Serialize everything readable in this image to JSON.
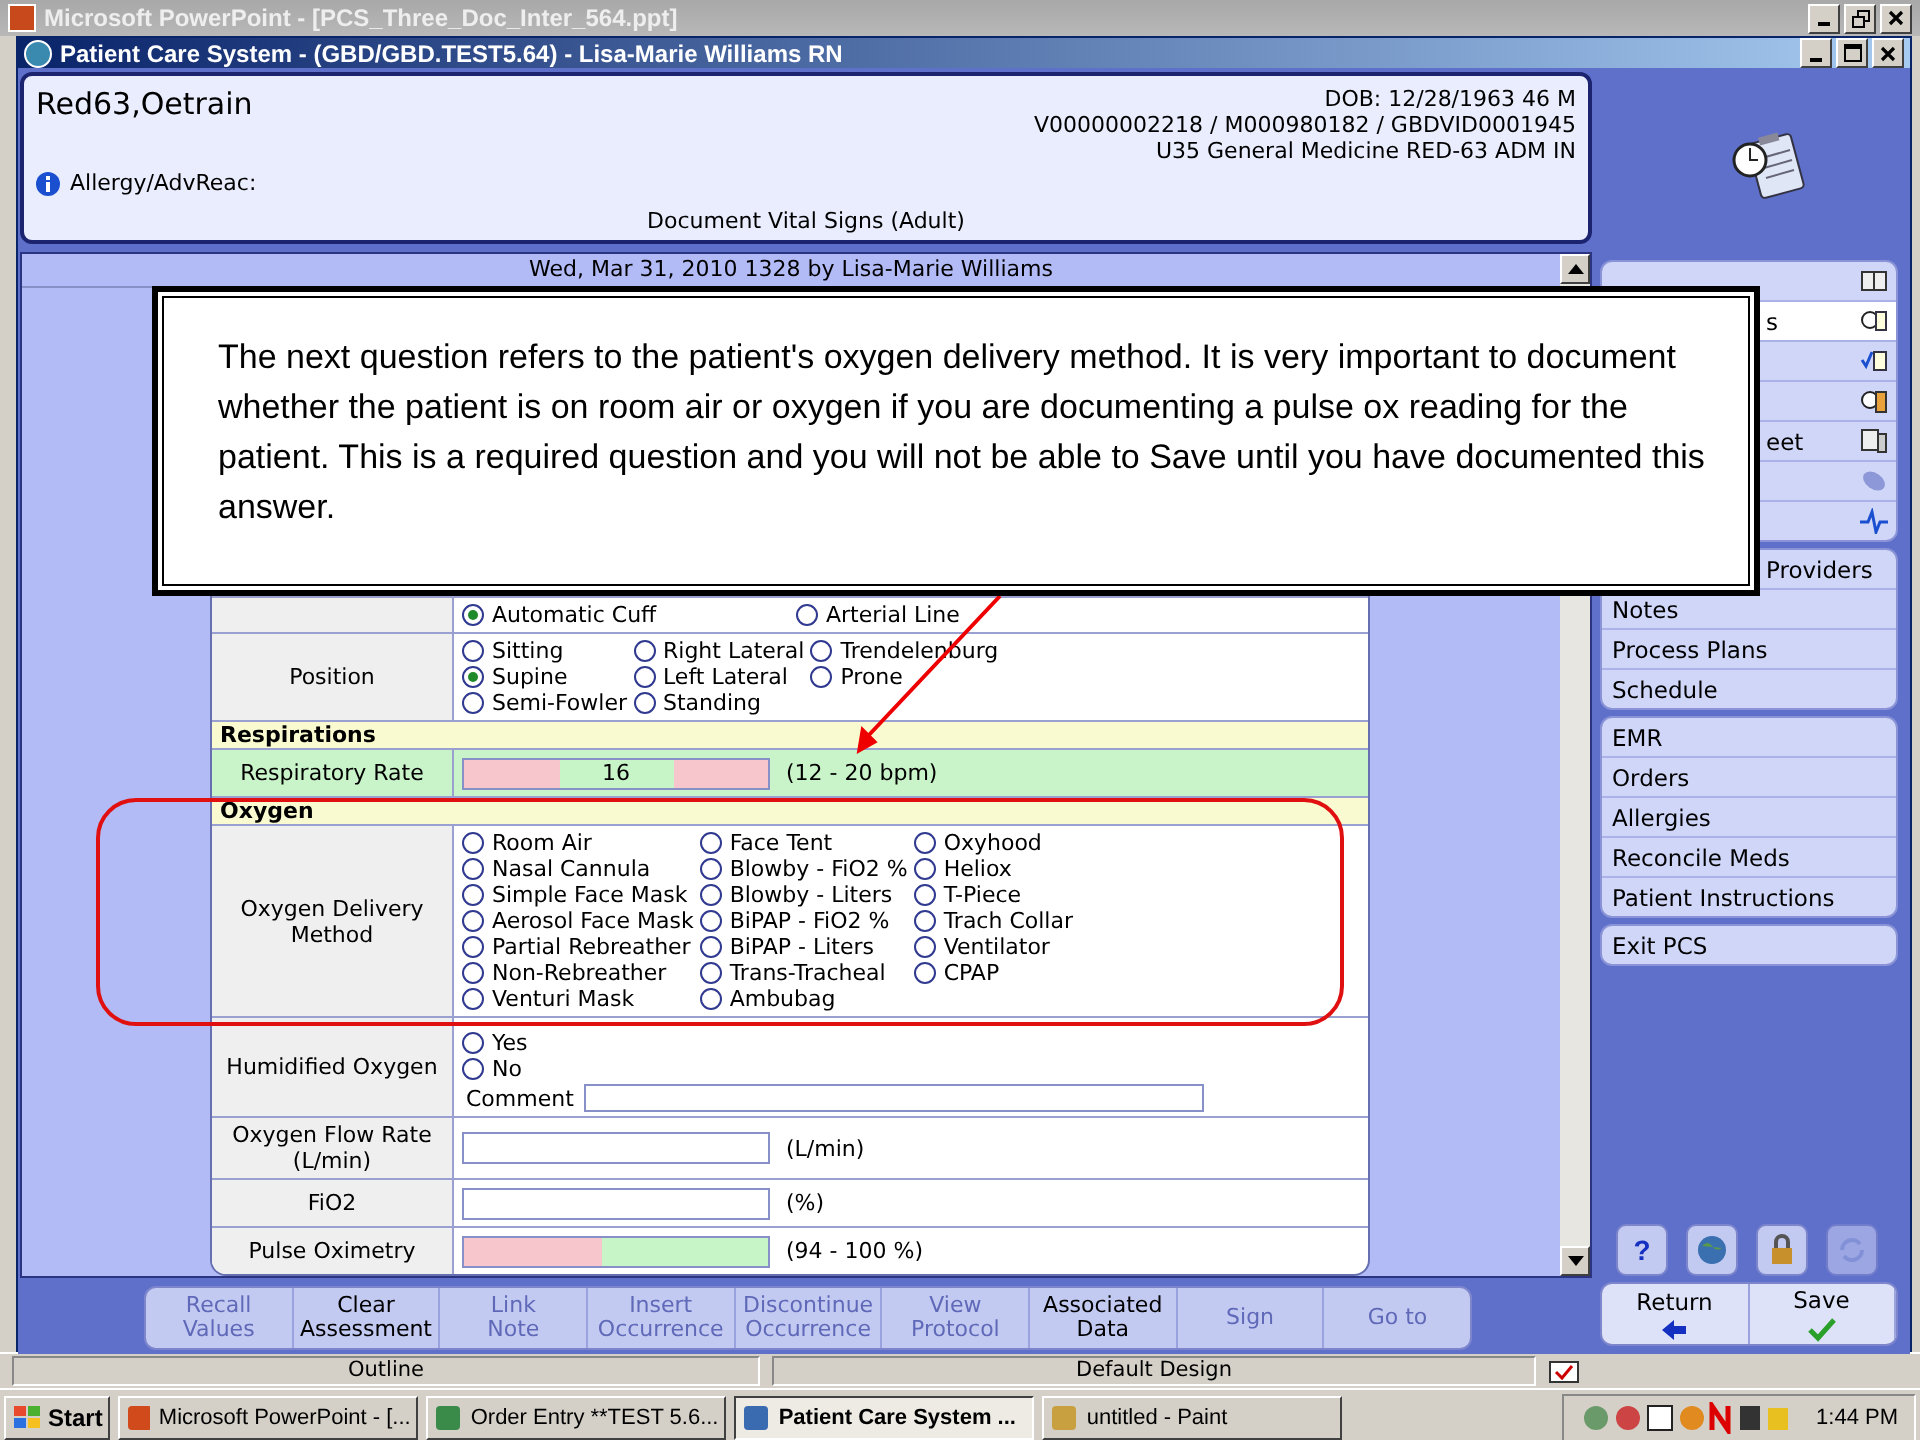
{
  "ppt_window": {
    "title": "Microsoft PowerPoint - [PCS_Three_Doc_Inter_564.ppt]"
  },
  "app_window": {
    "title": "Patient Care System - (GBD/GBD.TEST5.64) - Lisa-Marie Williams RN"
  },
  "patient": {
    "name": "Red63,Oetrain",
    "dob": "DOB: 12/28/1963 46 M",
    "ids": "V00000002218 / M000980182 / GBDVID0001945",
    "location": "U35 General Medicine  RED-63  ADM IN",
    "allergy_label": "Allergy/AdvReac:",
    "document_title": "Document Vital Signs (Adult)"
  },
  "document": {
    "header": "Wed,  Mar 31, 2010 1328  by  Lisa-Marie Williams"
  },
  "form": {
    "rows": [
      {
        "kind": "options",
        "columns": [
          [
            {
              "label": "Automatic Cuff",
              "checked": true
            }
          ],
          [
            {
              "label": "Arterial Line",
              "checked": false
            }
          ]
        ]
      },
      {
        "kind": "options",
        "label": "Position",
        "columns": [
          [
            {
              "label": "Sitting",
              "checked": false
            },
            {
              "label": "Supine",
              "checked": true
            },
            {
              "label": "Semi-Fowler",
              "checked": false
            }
          ],
          [
            {
              "label": "Right Lateral",
              "checked": false
            },
            {
              "label": "Left Lateral",
              "checked": false
            },
            {
              "label": "Standing",
              "checked": false
            }
          ],
          [
            {
              "label": "Trendelenburg",
              "checked": false
            },
            {
              "label": "Prone",
              "checked": false
            }
          ]
        ]
      },
      {
        "kind": "section",
        "label": "Respirations"
      },
      {
        "kind": "range",
        "label": "Respiratory Rate",
        "value": "16",
        "range": "(12 - 20 bpm)",
        "highlight": true,
        "zones": [
          {
            "color": "#f7c6cc"
          },
          {
            "color": "#c8f5c8"
          },
          {
            "color": "#f7c6cc"
          }
        ]
      },
      {
        "kind": "section",
        "label": "Oxygen"
      },
      {
        "kind": "options",
        "label": "Oxygen Delivery Method",
        "columns": [
          [
            {
              "label": "Room Air",
              "checked": false
            },
            {
              "label": "Nasal Cannula",
              "checked": false
            },
            {
              "label": "Simple Face Mask",
              "checked": false
            },
            {
              "label": "Aerosol Face Mask",
              "checked": false
            },
            {
              "label": "Partial Rebreather",
              "checked": false
            },
            {
              "label": "Non-Rebreather",
              "checked": false
            },
            {
              "label": "Venturi Mask",
              "checked": false
            }
          ],
          [
            {
              "label": "Face Tent",
              "checked": false
            },
            {
              "label": "Blowby - FiO2 %",
              "checked": false
            },
            {
              "label": "Blowby - Liters",
              "checked": false
            },
            {
              "label": "BiPAP - FiO2 %",
              "checked": false
            },
            {
              "label": "BiPAP - Liters",
              "checked": false
            },
            {
              "label": "Trans-Tracheal",
              "checked": false
            },
            {
              "label": "Ambubag",
              "checked": false
            }
          ],
          [
            {
              "label": "Oxyhood",
              "checked": false
            },
            {
              "label": "Heliox",
              "checked": false
            },
            {
              "label": "T-Piece",
              "checked": false
            },
            {
              "label": "Trach Collar",
              "checked": false
            },
            {
              "label": "Ventilator",
              "checked": false
            },
            {
              "label": "CPAP",
              "checked": false
            }
          ]
        ]
      },
      {
        "kind": "options",
        "label": "Humidified Oxygen",
        "columns": [
          [
            {
              "label": "Yes",
              "checked": false
            },
            {
              "label": "No",
              "checked": false
            }
          ]
        ],
        "comment_label": "Comment"
      },
      {
        "kind": "input",
        "label": "Oxygen Flow Rate (L/min)",
        "unit": "(L/min)"
      },
      {
        "kind": "input",
        "label": "FiO2",
        "unit": "(%)"
      },
      {
        "kind": "range",
        "label": "Pulse Oximetry",
        "range": "(94 - 100 %)",
        "highlight": false,
        "zones": [
          {
            "color": "#f7c6cc"
          },
          {
            "color": "#c8f5c8"
          }
        ]
      }
    ]
  },
  "overlay": {
    "text": "The next question refers to the patient's oxygen delivery method. It is very important to document whether the patient is on room air or oxygen if you are documenting a pulse ox reading for the patient. This is a required question and you will not be able to Save until you have documented this answer."
  },
  "sidebar": {
    "groups": [
      {
        "items": [
          {
            "selected": false
          },
          {
            "label": "s",
            "selected": true
          },
          {
            "selected": false
          },
          {
            "selected": false
          },
          {
            "label": "eet",
            "selected": false
          },
          {
            "selected": false
          },
          {
            "selected": false
          }
        ]
      },
      {
        "items": [
          {
            "label": "Providers",
            "selected": false
          },
          {
            "label": "Notes",
            "selected": false
          },
          {
            "label": "Process Plans",
            "selected": false
          },
          {
            "label": "Schedule",
            "selected": false
          }
        ]
      },
      {
        "items": [
          {
            "label": "EMR",
            "selected": false
          },
          {
            "label": "Orders",
            "selected": false
          },
          {
            "label": "Allergies",
            "selected": false
          },
          {
            "label": "Reconcile Meds",
            "selected": false
          },
          {
            "label": "Patient Instructions",
            "selected": false
          }
        ]
      },
      {
        "items": [
          {
            "label": "Exit PCS",
            "selected": false
          }
        ]
      }
    ]
  },
  "tool_buttons": [
    {
      "label": "?",
      "disabled": false
    },
    {
      "disabled": false
    },
    {
      "disabled": false
    },
    {
      "disabled": true
    }
  ],
  "actions": [
    {
      "label": "Recall\nValues",
      "disabled": true
    },
    {
      "label": "Clear\nAssessment",
      "disabled": false
    },
    {
      "label": "Link\nNote",
      "disabled": true
    },
    {
      "label": "Insert\nOccurrence",
      "disabled": true
    },
    {
      "label": "Discontinue\nOccurrence",
      "disabled": true
    },
    {
      "label": "View\nProtocol",
      "disabled": true
    },
    {
      "label": "Associated\nData",
      "disabled": false
    },
    {
      "label": "Sign",
      "disabled": true
    },
    {
      "label": "Go to",
      "disabled": true
    }
  ],
  "nav_buttons": [
    {
      "label": "Return"
    },
    {
      "label": "Save"
    }
  ],
  "ppt_status": [
    "Outline",
    "Default Design"
  ],
  "taskbar": {
    "start": "Start",
    "tasks": [
      {
        "label": "Microsoft PowerPoint - [...",
        "selected": false
      },
      {
        "label": "Order Entry **TEST 5.6...",
        "selected": false
      },
      {
        "label": "Patient Care System ...",
        "selected": true
      },
      {
        "label": "untitled - Paint",
        "selected": false
      }
    ],
    "clock": "1:44 PM"
  }
}
